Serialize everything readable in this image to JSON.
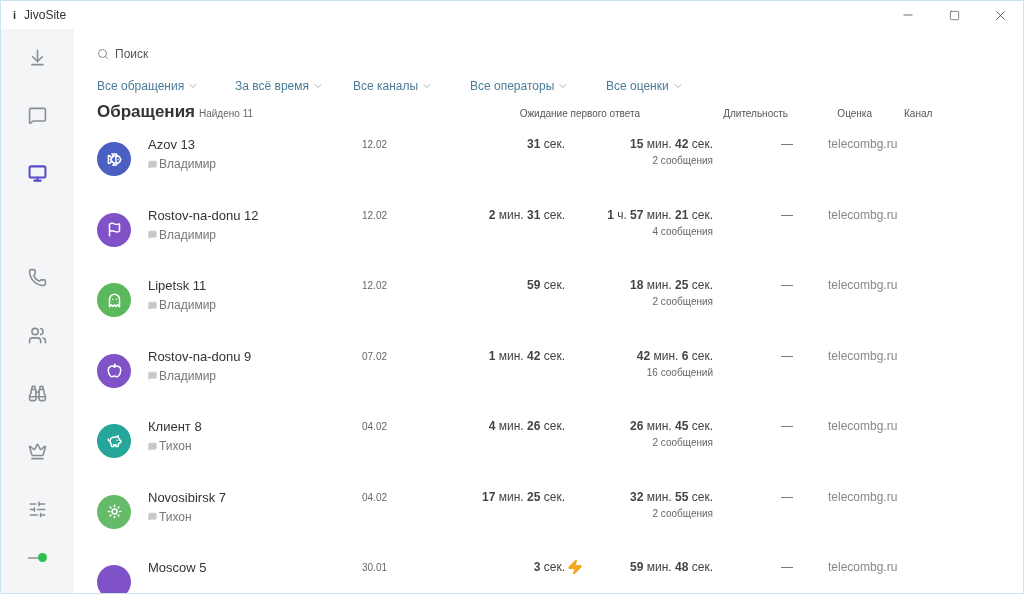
{
  "window": {
    "icon": "i",
    "title": "JivoSite"
  },
  "sidebar": {
    "items": [
      {
        "selected": false
      },
      {
        "selected": false
      },
      {
        "selected": true
      },
      {
        "selected": false
      },
      {
        "selected": false
      },
      {
        "selected": false
      },
      {
        "selected": false
      },
      {
        "selected": false
      }
    ],
    "status": {
      "online": true
    }
  },
  "search": {
    "placeholder": "Поиск"
  },
  "filters": [
    "Все обращения",
    "За всё время",
    "Все каналы",
    "Все операторы",
    "Все оценки"
  ],
  "heading": {
    "title": "Обращения",
    "found": "Найдено 11"
  },
  "columns": [
    "Ожидание первого ответа",
    "Длительность",
    "Оценка",
    "Канал"
  ],
  "rows": [
    {
      "name": "Azov 13",
      "operator": "Владимир",
      "color": "#4a5fc1",
      "date": "12.02",
      "wait": "**31** сек.",
      "fast": false,
      "duration": "**15** мин. **42** сек.",
      "messages": "2 сообщения",
      "rating": "—",
      "channel": "telecombg.ru"
    },
    {
      "name": "Rostov-na-donu 12",
      "operator": "Владимир",
      "color": "#8052c8",
      "date": "12.02",
      "wait": "**2** мин. **31** сек.",
      "fast": false,
      "duration": "**1** ч. **57** мин. **21** сек.",
      "messages": "4 сообщения",
      "rating": "—",
      "channel": "telecombg.ru"
    },
    {
      "name": "Lipetsk 11",
      "operator": "Владимир",
      "color": "#5cb85c",
      "date": "12.02",
      "wait": "**59** сек.",
      "fast": false,
      "duration": "**18** мин. **25** сек.",
      "messages": "2 сообщения",
      "rating": "—",
      "channel": "telecombg.ru"
    },
    {
      "name": "Rostov-na-donu 9",
      "operator": "Владимир",
      "color": "#8052c8",
      "date": "07.02",
      "wait": "**1** мин. **42** сек.",
      "fast": false,
      "duration": "**42** мин. **6** сек.",
      "messages": "16 сообщений",
      "rating": "—",
      "channel": "telecombg.ru"
    },
    {
      "name": "Клиент 8",
      "operator": "Тихон",
      "color": "#26a69a",
      "date": "04.02",
      "wait": "**4** мин. **26** сек.",
      "fast": false,
      "duration": "**26** мин. **45** сек.",
      "messages": "2 сообщения",
      "rating": "—",
      "channel": "telecombg.ru"
    },
    {
      "name": "Novosibirsk 7",
      "operator": "Тихон",
      "color": "#66bb6a",
      "date": "04.02",
      "wait": "**17** мин. **25** сек.",
      "fast": false,
      "duration": "**32** мин. **55** сек.",
      "messages": "2 сообщения",
      "rating": "—",
      "channel": "telecombg.ru"
    },
    {
      "name": "Moscow 5",
      "color": "#8052c8",
      "date": "30.01",
      "wait": "**3** сек.",
      "fast": true,
      "duration": "**59** мин. **48** сек.",
      "rating": "—",
      "channel": "telecombg.ru"
    }
  ]
}
